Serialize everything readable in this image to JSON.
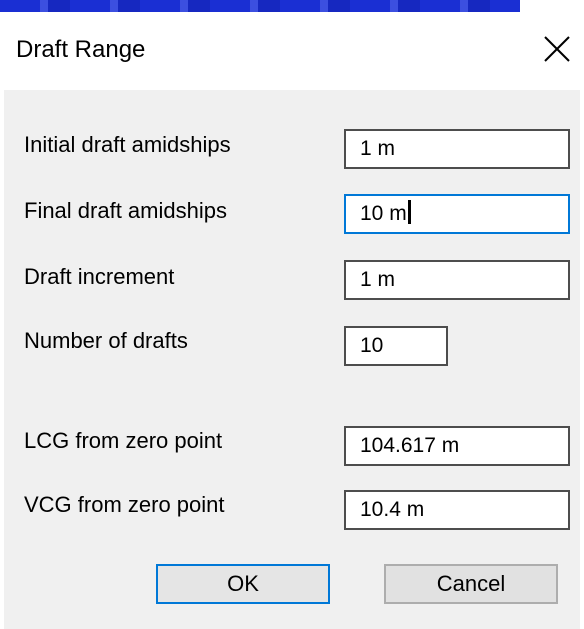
{
  "dialog": {
    "title": "Draft Range",
    "close_icon": "close-icon"
  },
  "fields": {
    "initial_draft": {
      "label": "Initial draft amidships",
      "value": "1 m"
    },
    "final_draft": {
      "label": "Final draft amidships",
      "value": "10 m"
    },
    "draft_increment": {
      "label": "Draft increment",
      "value": "1 m"
    },
    "number_of_drafts": {
      "label": "Number of drafts",
      "value": "10"
    },
    "lcg": {
      "label": "LCG from zero point",
      "value": "104.617 m"
    },
    "vcg": {
      "label": "VCG from zero point",
      "value": "10.4 m"
    }
  },
  "buttons": {
    "ok": "OK",
    "cancel": "Cancel"
  },
  "colors": {
    "focus_border": "#0078d7",
    "client_bg": "#f0f0f0"
  }
}
